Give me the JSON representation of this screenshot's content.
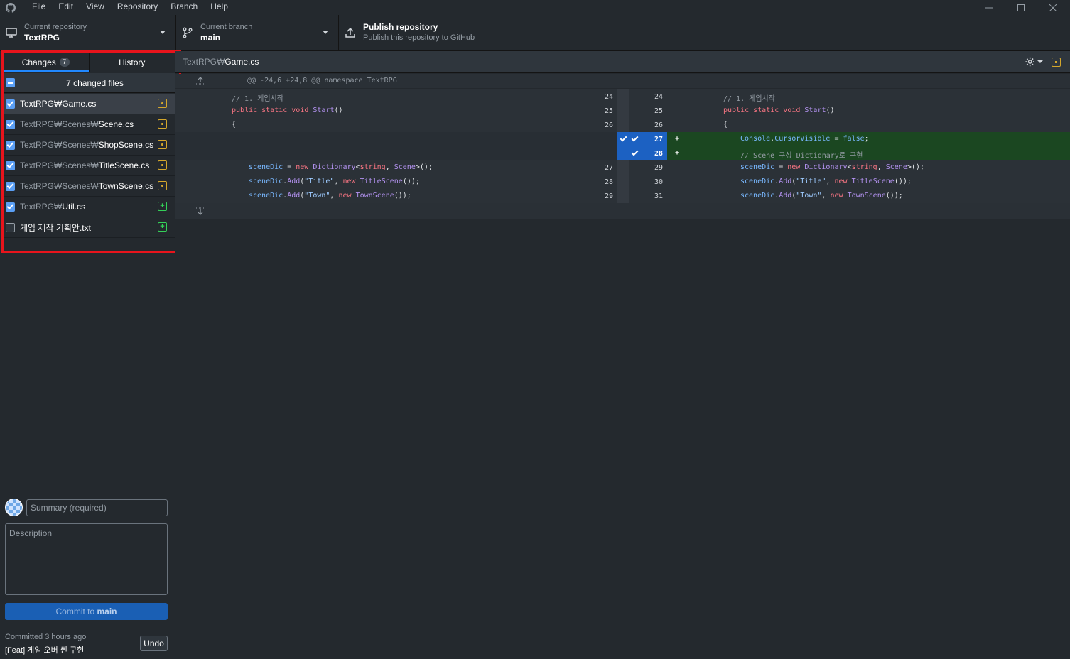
{
  "menu": [
    "File",
    "Edit",
    "View",
    "Repository",
    "Branch",
    "Help"
  ],
  "toolbar": {
    "repo_label": "Current repository",
    "repo_value": "TextRPG",
    "branch_label": "Current branch",
    "branch_value": "main",
    "publish_title": "Publish repository",
    "publish_subtitle": "Publish this repository to GitHub"
  },
  "sidebar": {
    "tabs": {
      "changes": "Changes",
      "changes_count": "7",
      "history": "History"
    },
    "changed_header": "7 changed files",
    "files": [
      {
        "dir": "",
        "name": "TextRPG₩Game.cs",
        "checked": true,
        "status": "modified"
      },
      {
        "dir": "TextRPG₩Scenes₩",
        "name": "Scene.cs",
        "checked": true,
        "status": "modified"
      },
      {
        "dir": "TextRPG₩Scenes₩",
        "name": "ShopScene.cs",
        "checked": true,
        "status": "modified"
      },
      {
        "dir": "TextRPG₩Scenes₩",
        "name": "TitleScene.cs",
        "checked": true,
        "status": "modified"
      },
      {
        "dir": "TextRPG₩Scenes₩",
        "name": "TownScene.cs",
        "checked": true,
        "status": "modified"
      },
      {
        "dir": "TextRPG₩",
        "name": "Util.cs",
        "checked": true,
        "status": "added"
      },
      {
        "dir": "",
        "name": "게임 제작 기획안.txt",
        "checked": false,
        "status": "added"
      }
    ]
  },
  "commit": {
    "summary_placeholder": "Summary (required)",
    "description_placeholder": "Description",
    "button_prefix": "Commit to ",
    "button_branch": "main",
    "last_time": "Committed 3 hours ago",
    "last_message": "[Feat] 게임 오버 씬 구현",
    "undo": "Undo"
  },
  "diff": {
    "path_dir": "TextRPG₩",
    "path_file": "Game.cs",
    "hunk": "@@ -24,6 +24,8 @@ namespace TextRPG",
    "rows": [
      {
        "old": "24",
        "new": "24",
        "type": "context",
        "indent": 0,
        "tokens": [
          [
            "cm",
            "// 1. 게임시작"
          ]
        ]
      },
      {
        "old": "25",
        "new": "25",
        "type": "context",
        "indent": 0,
        "tokens": [
          [
            "kw",
            "public static void "
          ],
          [
            "ty",
            "Start"
          ],
          [
            "",
            "()"
          ]
        ]
      },
      {
        "old": "26",
        "new": "26",
        "type": "context",
        "indent": 0,
        "tokens": [
          [
            "",
            "{"
          ]
        ]
      },
      {
        "old": "",
        "new": "27",
        "type": "added",
        "indent": 1,
        "tokens": [
          [
            "id",
            "Console"
          ],
          [
            "",
            "."
          ],
          [
            "id",
            "CursorVisible"
          ],
          [
            "",
            " = "
          ],
          [
            "bool",
            "false"
          ],
          [
            "",
            ";"
          ]
        ]
      },
      {
        "old": "",
        "new": "28",
        "type": "added",
        "indent": 1,
        "tokens": [
          [
            "cm",
            "// Scene 구성 Dictionary로 구현"
          ]
        ]
      },
      {
        "old": "27",
        "new": "29",
        "type": "context",
        "indent": 1,
        "tokens": [
          [
            "id",
            "sceneDic"
          ],
          [
            "",
            " = "
          ],
          [
            "kw",
            "new "
          ],
          [
            "ty",
            "Dictionary"
          ],
          [
            "",
            "<"
          ],
          [
            "kw",
            "string"
          ],
          [
            "",
            ", "
          ],
          [
            "ty",
            "Scene"
          ],
          [
            "",
            ">();"
          ]
        ]
      },
      {
        "old": "28",
        "new": "30",
        "type": "context",
        "indent": 1,
        "tokens": [
          [
            "id",
            "sceneDic"
          ],
          [
            "",
            "."
          ],
          [
            "ty",
            "Add"
          ],
          [
            "",
            "("
          ],
          [
            "st",
            "\"Title\""
          ],
          [
            "",
            ", "
          ],
          [
            "kw",
            "new "
          ],
          [
            "ty",
            "TitleScene"
          ],
          [
            "",
            "());"
          ]
        ]
      },
      {
        "old": "29",
        "new": "31",
        "type": "context",
        "indent": 1,
        "tokens": [
          [
            "id",
            "sceneDic"
          ],
          [
            "",
            "."
          ],
          [
            "ty",
            "Add"
          ],
          [
            "",
            "("
          ],
          [
            "st",
            "\"Town\""
          ],
          [
            "",
            ", "
          ],
          [
            "kw",
            "new "
          ],
          [
            "ty",
            "TownScene"
          ],
          [
            "",
            "());"
          ]
        ]
      }
    ]
  },
  "colors": {
    "accent": "#2188ff",
    "added_bg": "#1b4721",
    "selected_gutter": "#1c61c2",
    "modified": "#d4a72c",
    "added": "#34d058",
    "highlight_box": "#e8141c"
  }
}
